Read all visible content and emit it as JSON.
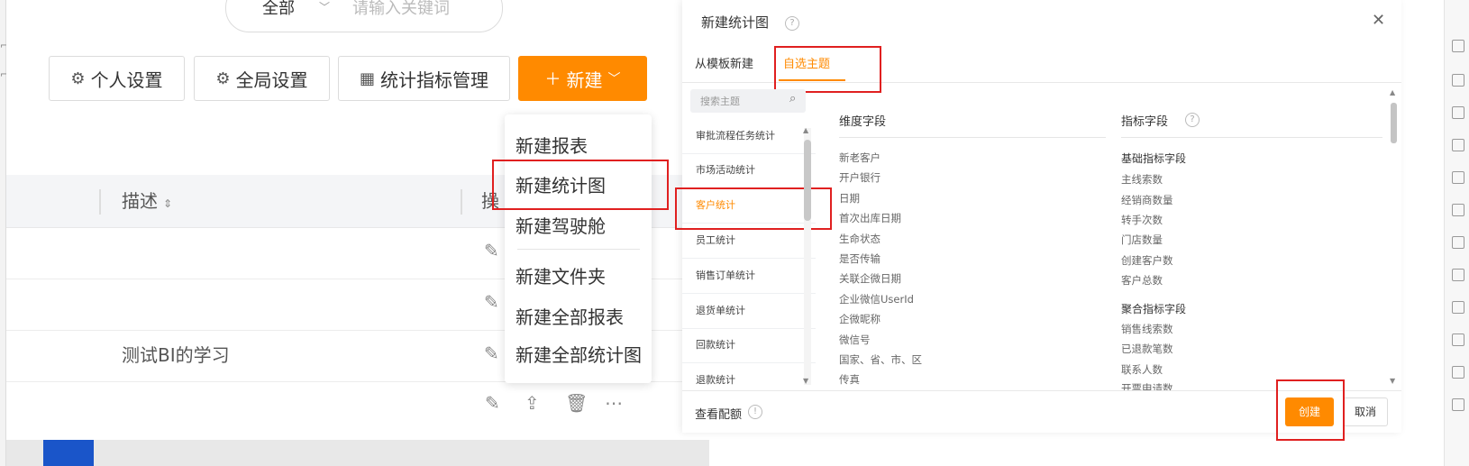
{
  "background": {
    "search": {
      "scope": "全部",
      "placeholder": "请输入关键词"
    },
    "toolbar": {
      "personal_settings": "个人设置",
      "global_settings": "全局设置",
      "metrics_management": "统计指标管理",
      "new_button": "新建"
    },
    "new_menu": {
      "items": [
        "新建报表",
        "新建统计图",
        "新建驾驶舱",
        "新建文件夹",
        "新建全部报表",
        "新建全部统计图"
      ]
    },
    "table": {
      "columns": {
        "description": "描述",
        "actions": "操"
      },
      "rows": [
        {
          "description": ""
        },
        {
          "description": ""
        },
        {
          "description": "测试BI的学习"
        },
        {
          "description": ""
        }
      ]
    }
  },
  "dialog": {
    "title": "新建统计图",
    "tabs": [
      "从模板新建",
      "自选主题"
    ],
    "active_tab": "自选主题",
    "topic_search_placeholder": "搜索主题",
    "topics": [
      "审批流程任务统计",
      "市场活动统计",
      "客户统计",
      "员工统计",
      "销售订单统计",
      "退货单统计",
      "回款统计",
      "退款统计"
    ],
    "active_topic": "客户统计",
    "dimension_header": "维度字段",
    "dimension_fields": [
      "新老客户",
      "开户银行",
      "日期",
      "首次出库日期",
      "生命状态",
      "是否传输",
      "关联企微日期",
      "企业微信UserId",
      "企微昵称",
      "微信号",
      "国家、省、市、区",
      "传真"
    ],
    "metric_header": "指标字段",
    "metric_groups": [
      {
        "name": "基础指标字段",
        "fields": [
          "主线索数",
          "经销商数量",
          "转手次数",
          "门店数量",
          "创建客户数",
          "客户总数"
        ]
      },
      {
        "name": "聚合指标字段",
        "fields": [
          "销售线索数",
          "已退款笔数",
          "联系人数",
          "开票申请数"
        ]
      }
    ],
    "footer_link": "查看配额",
    "create_label": "创建",
    "cancel_label": "取消"
  },
  "colors": {
    "accent": "#ff8a00",
    "highlight_box": "#e02020",
    "brand_blue": "#1a55c9"
  }
}
